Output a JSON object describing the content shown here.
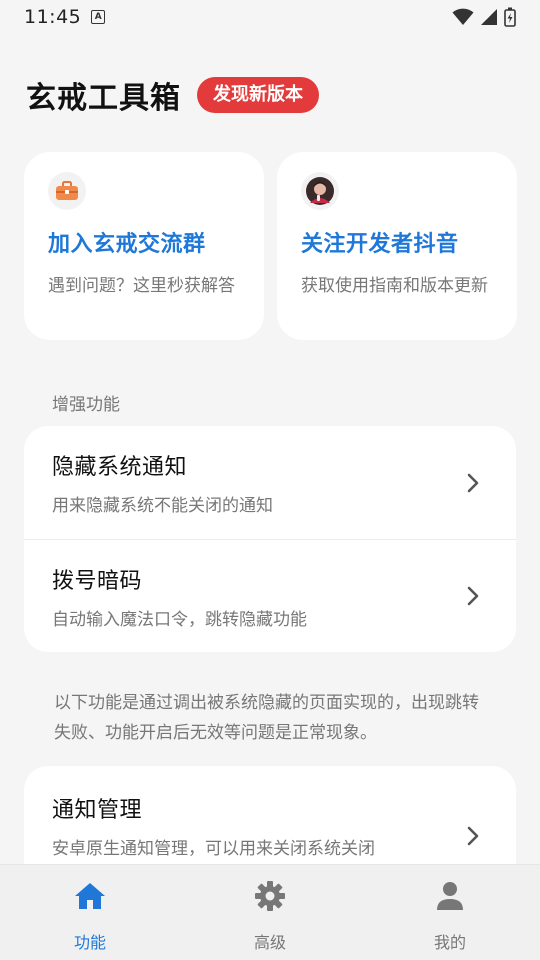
{
  "status_bar": {
    "time": "11:45",
    "notification_icon": "a-box-icon",
    "icons": [
      "wifi-icon",
      "signal-icon",
      "battery-charging-icon"
    ]
  },
  "header": {
    "title": "玄戒工具箱",
    "badge": "发现新版本"
  },
  "promo": [
    {
      "icon": "briefcase-icon",
      "title": "加入玄戒交流群",
      "desc": "遇到问题？这里秒获解答"
    },
    {
      "icon": "avatar-icon",
      "title": "关注开发者抖音",
      "desc": "获取使用指南和版本更新"
    }
  ],
  "enhanced": {
    "section_label": "增强功能",
    "items": [
      {
        "title": "隐藏系统通知",
        "subtitle": "用来隐藏系统不能关闭的通知"
      },
      {
        "title": "拨号暗码",
        "subtitle": "自动输入魔法口令，跳转隐藏功能"
      }
    ]
  },
  "notice": "以下功能是通过调出被系统隐藏的页面实现的，出现跳转失败、功能开启后无效等问题是正常现象。",
  "hidden_pages": {
    "items": [
      {
        "title": "通知管理",
        "subtitle": "安卓原生通知管理，可以用来关闭系统关闭"
      }
    ]
  },
  "bottom_nav": {
    "items": [
      {
        "label": "功能",
        "icon": "home-icon",
        "active": true
      },
      {
        "label": "高级",
        "icon": "gear-icon",
        "active": false
      },
      {
        "label": "我的",
        "icon": "person-icon",
        "active": false
      }
    ]
  },
  "colors": {
    "accent": "#1f78d8",
    "badge": "#e33b3b",
    "background": "#f5f5f5",
    "card": "#ffffff",
    "muted_text": "#777777"
  }
}
